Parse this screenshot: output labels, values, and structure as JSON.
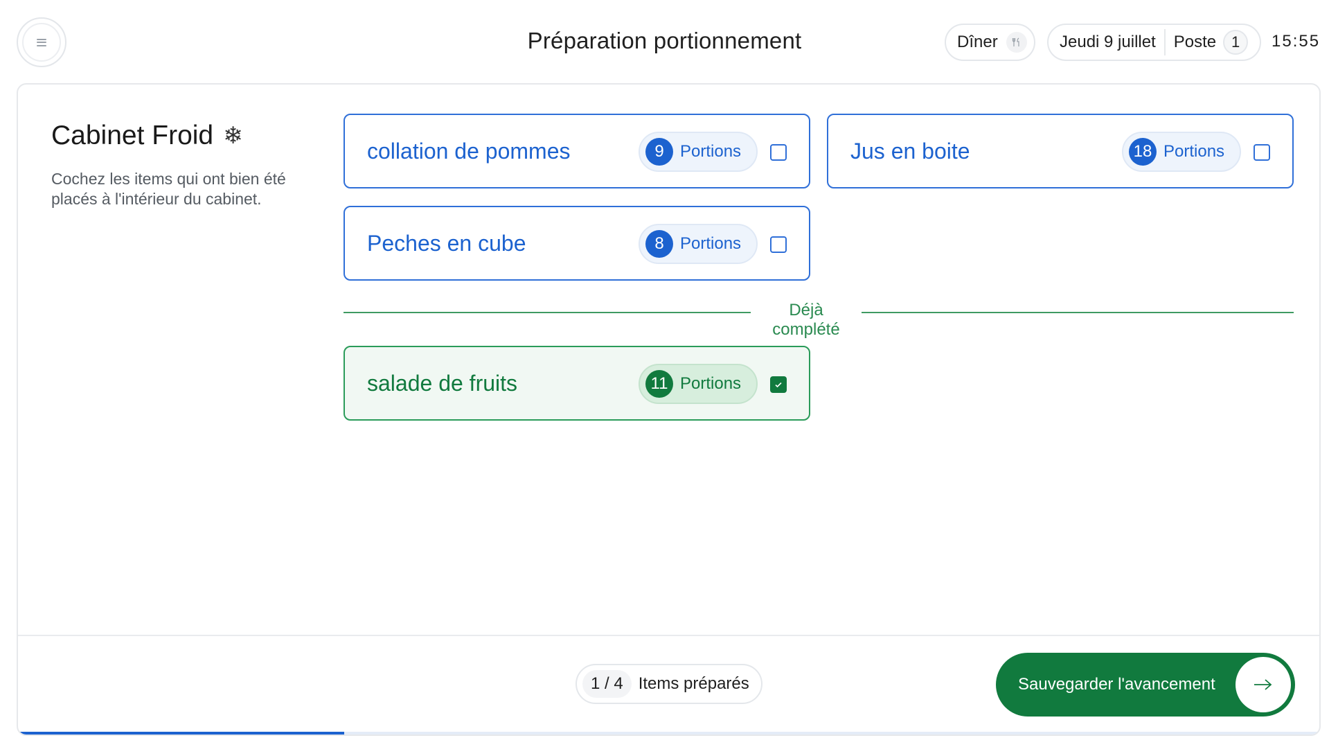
{
  "header": {
    "title": "Préparation portionnement",
    "meal": "Dîner",
    "date": "Jeudi 9 juillet",
    "poste_label": "Poste",
    "poste_number": "1",
    "time": "15:55"
  },
  "section": {
    "title": "Cabinet Froid",
    "icon": "snowflake-icon",
    "description": "Cochez les items qui ont bien été placés à l'intérieur du cabinet."
  },
  "pending_items": [
    {
      "name": "collation de pommes",
      "portions": "9",
      "portions_label": "Portions",
      "checked": false
    },
    {
      "name": "Jus en boite",
      "portions": "18",
      "portions_label": "Portions",
      "checked": false
    },
    {
      "name": "Peches en cube",
      "portions": "8",
      "portions_label": "Portions",
      "checked": false
    }
  ],
  "completed_divider": "Déjà complété",
  "completed_items": [
    {
      "name": "salade de fruits",
      "portions": "11",
      "portions_label": "Portions",
      "checked": true
    }
  ],
  "footer": {
    "progress_count": "1 / 4",
    "progress_label": "Items préparés",
    "save_label": "Sauvegarder l'avancement",
    "progress_fraction": 0.25
  },
  "colors": {
    "accent_blue": "#1c62cf",
    "accent_green": "#117a3e"
  }
}
